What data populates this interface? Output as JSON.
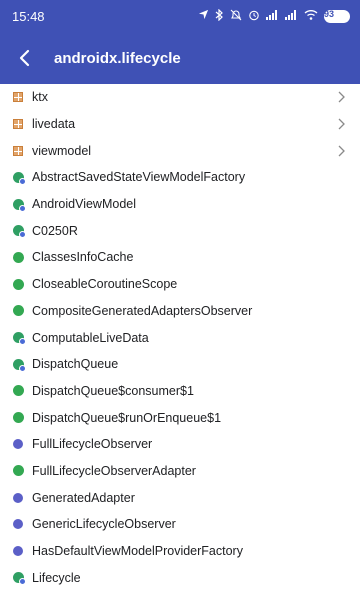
{
  "status_bar": {
    "time": "15:48",
    "battery": "93"
  },
  "app_bar": {
    "title": "androidx.lifecycle"
  },
  "items": [
    {
      "label": "ktx",
      "kind": "package",
      "chevron": true
    },
    {
      "label": "livedata",
      "kind": "package",
      "chevron": true
    },
    {
      "label": "viewmodel",
      "kind": "package",
      "chevron": true
    },
    {
      "label": "AbstractSavedStateViewModelFactory",
      "kind": "abstract-class"
    },
    {
      "label": "AndroidViewModel",
      "kind": "abstract-class"
    },
    {
      "label": "C0250R",
      "kind": "abstract-class"
    },
    {
      "label": "ClassesInfoCache",
      "kind": "class"
    },
    {
      "label": "CloseableCoroutineScope",
      "kind": "class"
    },
    {
      "label": "CompositeGeneratedAdaptersObserver",
      "kind": "class"
    },
    {
      "label": "ComputableLiveData",
      "kind": "abstract-class"
    },
    {
      "label": "DispatchQueue",
      "kind": "abstract-class"
    },
    {
      "label": "DispatchQueue$consumer$1",
      "kind": "class"
    },
    {
      "label": "DispatchQueue$runOrEnqueue$1",
      "kind": "class"
    },
    {
      "label": "FullLifecycleObserver",
      "kind": "interface"
    },
    {
      "label": "FullLifecycleObserverAdapter",
      "kind": "class"
    },
    {
      "label": "GeneratedAdapter",
      "kind": "interface"
    },
    {
      "label": "GenericLifecycleObserver",
      "kind": "interface"
    },
    {
      "label": "HasDefaultViewModelProviderFactory",
      "kind": "interface"
    },
    {
      "label": "Lifecycle",
      "kind": "abstract-class"
    }
  ]
}
